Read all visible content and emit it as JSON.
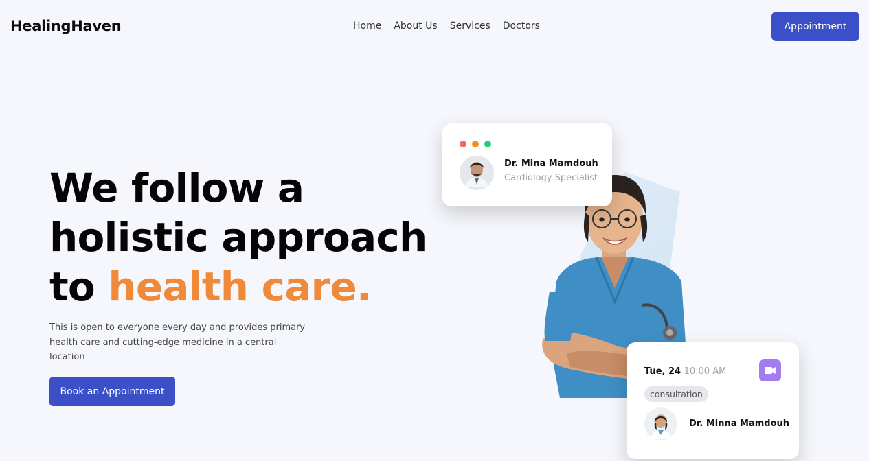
{
  "nav": {
    "brand": "HealingHaven",
    "links": [
      "Home",
      "About Us",
      "Services",
      "Doctors"
    ],
    "cta_label": "Appointment"
  },
  "hero": {
    "title_line1": "We follow a",
    "title_line2": "holistic approach",
    "title_line3_plain": "to ",
    "title_line3_accent": "health care.",
    "description": "This is open to everyone every day and provides primary health care and cutting-edge medicine in a central location",
    "button_label": "Book an Appointment"
  },
  "doctor_card": {
    "window_dots": [
      "#ef6b6b",
      "#f0901f",
      "#25cf7a"
    ],
    "name": "Dr. Mina Mamdouh",
    "specialty": "Cardiology Specialist"
  },
  "appointment_card": {
    "date": "Tue, 24",
    "time": "10:00 AM",
    "tag": "consultation",
    "doctor_name": "Dr. Minna Mamdouh",
    "video_icon": "video-camera-icon"
  },
  "colors": {
    "primary": "#3b4fc7",
    "accent": "#ef8a3b",
    "background": "#f5f7fc",
    "video": "#a57bf0"
  }
}
